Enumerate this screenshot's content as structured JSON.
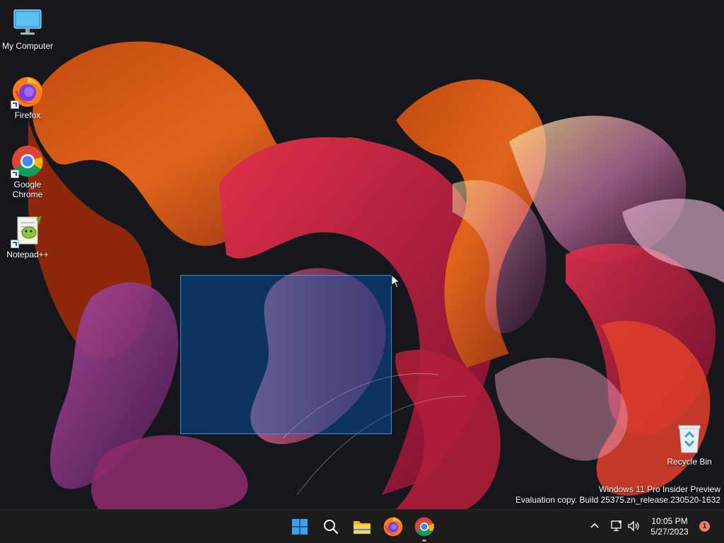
{
  "desktop": {
    "icons": [
      {
        "label": "My Computer",
        "icon": "computer-icon"
      },
      {
        "label": "Firefox",
        "icon": "firefox-icon"
      },
      {
        "label": "Google\nChrome",
        "icon": "chrome-icon"
      },
      {
        "label": "Notepad++",
        "icon": "notepadpp-icon"
      },
      {
        "label": "Recycle Bin",
        "icon": "recycle-bin-icon"
      }
    ],
    "watermark": {
      "line1": "Windows 11 Pro Insider Preview",
      "line2": "Evaluation copy. Build 25375.zn_release.230520-1632"
    }
  },
  "taskbar": {
    "apps": [
      {
        "name": "Start",
        "icon": "windows-start-icon"
      },
      {
        "name": "Search",
        "icon": "search-icon"
      },
      {
        "name": "File Explorer",
        "icon": "folder-icon"
      },
      {
        "name": "Firefox",
        "icon": "firefox-icon"
      },
      {
        "name": "Google Chrome",
        "icon": "chrome-icon",
        "running": true
      }
    ],
    "tray": {
      "time": "10:05 PM",
      "date": "5/27/2023",
      "notifications": "1"
    }
  },
  "colors": {
    "taskbar_bg": "#1c1c1c",
    "selection_fill": "#0066cc",
    "selection_border": "#3a8ee0",
    "notification_badge": "#f07a72"
  }
}
